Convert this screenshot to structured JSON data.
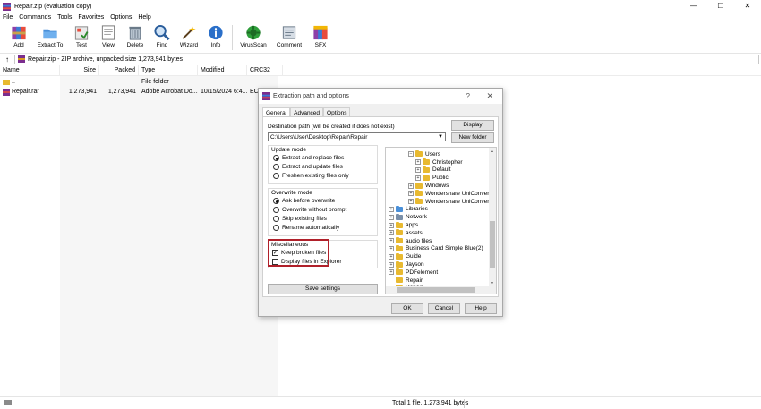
{
  "window": {
    "title": "Repair.zip (evaluation copy)",
    "minimize": "—",
    "maximize": "☐",
    "close": "✕"
  },
  "menu": [
    "File",
    "Commands",
    "Tools",
    "Favorites",
    "Options",
    "Help"
  ],
  "toolbar": [
    {
      "label": "Add",
      "icon": "add-archive-icon"
    },
    {
      "label": "Extract To",
      "icon": "extract-folder-icon"
    },
    {
      "label": "Test",
      "icon": "test-icon"
    },
    {
      "label": "View",
      "icon": "view-icon"
    },
    {
      "label": "Delete",
      "icon": "delete-icon"
    },
    {
      "label": "Find",
      "icon": "find-icon"
    },
    {
      "label": "Wizard",
      "icon": "wizard-icon"
    },
    {
      "label": "Info",
      "icon": "info-icon"
    },
    {
      "label": "VirusScan",
      "icon": "virus-scan-icon"
    },
    {
      "label": "Comment",
      "icon": "comment-icon"
    },
    {
      "label": "SFX",
      "icon": "sfx-icon"
    }
  ],
  "address": {
    "up": "↑",
    "path": "Repair.zip - ZIP archive, unpacked size 1,273,941 bytes"
  },
  "columns": [
    "Name",
    "Size",
    "Packed",
    "Type",
    "Modified",
    "CRC32"
  ],
  "files": [
    {
      "name": "..",
      "size": "",
      "packed": "",
      "type": "File folder",
      "modified": "",
      "crc": ""
    },
    {
      "name": "Repair.rar",
      "size": "1,273,941",
      "packed": "1,273,941",
      "type": "Adobe Acrobat Do...",
      "modified": "10/15/2024 6:4...",
      "crc": "EC"
    }
  ],
  "status": "Total 1 file, 1,273,941 bytes",
  "dialog": {
    "title": "Extraction path and options",
    "help_glyph": "?",
    "close_glyph": "✕",
    "tabs": [
      "General",
      "Advanced",
      "Options"
    ],
    "dest_label": "Destination path (will be created if does not exist)",
    "dest_value": "C:\\Users\\User\\Desktop\\Repair\\Repair",
    "display_btn": "Display",
    "new_folder_btn": "New folder",
    "update_mode": {
      "title": "Update mode",
      "options": [
        "Extract and replace files",
        "Extract and update files",
        "Freshen existing files only"
      ],
      "selected": 0
    },
    "overwrite_mode": {
      "title": "Overwrite mode",
      "options": [
        "Ask before overwrite",
        "Overwrite without prompt",
        "Skip existing files",
        "Rename automatically"
      ],
      "selected": 0
    },
    "misc": {
      "title": "Miscellaneous",
      "keep_broken": "Keep broken files",
      "keep_broken_checked": true,
      "display_explorer": "Display files in Explorer",
      "display_explorer_checked": false
    },
    "save_settings": "Save settings",
    "ok": "OK",
    "cancel": "Cancel",
    "help": "Help",
    "tree": [
      {
        "label": "Users",
        "level": 1,
        "pm": "−",
        "color": "yellow"
      },
      {
        "label": "Christopher",
        "level": 2,
        "pm": "+",
        "color": "yellow"
      },
      {
        "label": "Default",
        "level": 2,
        "pm": "+",
        "color": "yellow"
      },
      {
        "label": "Public",
        "level": 2,
        "pm": "+",
        "color": "yellow"
      },
      {
        "label": "Windows",
        "level": 1,
        "pm": "+",
        "color": "yellow"
      },
      {
        "label": "Wondershare UniConverter 1",
        "level": 1,
        "pm": "+",
        "color": "yellow"
      },
      {
        "label": "Wondershare UniConverter 1",
        "level": 1,
        "pm": "+",
        "color": "yellow"
      },
      {
        "label": "Libraries",
        "level": 0,
        "pm": "+",
        "color": "blue"
      },
      {
        "label": "Network",
        "level": 0,
        "pm": "+",
        "color": "gray"
      },
      {
        "label": "apps",
        "level": 0,
        "pm": "+",
        "color": "yellow"
      },
      {
        "label": "assets",
        "level": 0,
        "pm": "+",
        "color": "yellow"
      },
      {
        "label": "audio files",
        "level": 0,
        "pm": "+",
        "color": "yellow"
      },
      {
        "label": "Business Card Simple Blue(2)",
        "level": 0,
        "pm": "+",
        "color": "yellow"
      },
      {
        "label": "Guide",
        "level": 0,
        "pm": "+",
        "color": "yellow"
      },
      {
        "label": "Jayson",
        "level": 0,
        "pm": "+",
        "color": "yellow"
      },
      {
        "label": "PDFelement",
        "level": 0,
        "pm": "+",
        "color": "yellow"
      },
      {
        "label": "Repair",
        "level": 0,
        "pm": "",
        "color": "yellow"
      },
      {
        "label": "Repair",
        "level": 0,
        "pm": "",
        "color": "yellow"
      }
    ]
  }
}
